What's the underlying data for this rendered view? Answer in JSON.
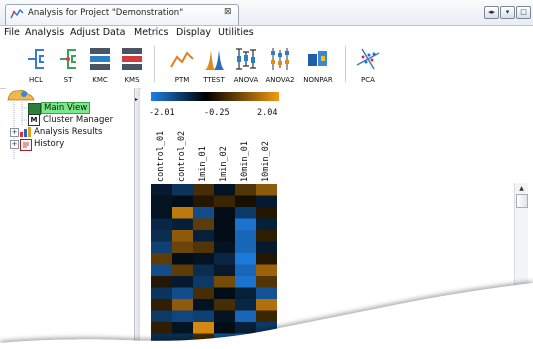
{
  "tab": {
    "title": "Analysis for Project \"Demonstration\"",
    "close": "⊠"
  },
  "window_controls": [
    "◂▸",
    "▾",
    "□"
  ],
  "menu": [
    "File",
    "Analysis",
    "Adjust Data",
    "Metrics",
    "Display",
    "Utilities"
  ],
  "toolbar": [
    {
      "label": "HCL",
      "icon": "hcl-tree-icon"
    },
    {
      "label": "ST",
      "icon": "support-tree-icon"
    },
    {
      "label": "KMC",
      "icon": "kmeans-cluster-icon"
    },
    {
      "label": "KMS",
      "icon": "kmeans-support-icon"
    },
    {
      "label": "PTM",
      "icon": "template-match-icon"
    },
    {
      "label": "TTEST",
      "icon": "ttest-icon"
    },
    {
      "label": "ANOVA",
      "icon": "anova-icon"
    },
    {
      "label": "ANOVA2",
      "icon": "anova2-icon"
    },
    {
      "label": "NONPAR",
      "icon": "nonparametric-icon"
    },
    {
      "label": "PCA",
      "icon": "pca-icon"
    }
  ],
  "tree": {
    "items": [
      {
        "label": "Main View",
        "selected": true
      },
      {
        "label": "Cluster Manager"
      },
      {
        "label": "Analysis Results"
      },
      {
        "label": "History"
      }
    ],
    "expander": "+"
  },
  "heatmap": {
    "scale_labels": [
      "-2.01",
      "-0.25",
      "2.04"
    ],
    "scale_min": -2.01,
    "scale_max": 2.04,
    "colors": {
      "low": "#1e80e6",
      "mid": "#000000",
      "high": "#f09a12"
    },
    "columns": [
      "control_01",
      "control_02",
      "1min_01",
      "1min_02",
      "10min_01",
      "10min_02"
    ],
    "values": [
      [
        -0.4,
        -0.8,
        0.6,
        -0.3,
        0.7,
        1.2
      ],
      [
        -0.3,
        -0.2,
        0.3,
        0.5,
        0.2,
        -0.4
      ],
      [
        -0.3,
        1.6,
        -1.2,
        -0.2,
        -0.9,
        0.3
      ],
      [
        -0.6,
        -0.5,
        0.8,
        -0.2,
        -1.8,
        -0.5
      ],
      [
        -0.7,
        1.2,
        -0.5,
        -0.2,
        -1.6,
        0.4
      ],
      [
        -1.0,
        0.9,
        0.7,
        -0.3,
        -1.6,
        -0.4
      ],
      [
        0.8,
        -0.2,
        -0.3,
        -0.6,
        -1.9,
        0.3
      ],
      [
        -1.2,
        0.8,
        -0.7,
        -0.4,
        -1.6,
        1.3
      ],
      [
        0.3,
        -0.4,
        -0.9,
        1.0,
        -1.8,
        0.7
      ],
      [
        -0.8,
        -1.2,
        0.6,
        -0.2,
        -0.5,
        -1.3
      ],
      [
        0.4,
        1.2,
        -0.3,
        0.6,
        -0.6,
        1.5
      ],
      [
        -0.9,
        -1.1,
        -1.0,
        -0.3,
        -1.6,
        0.5
      ],
      [
        0.4,
        -0.3,
        1.8,
        -0.2,
        -0.5,
        -0.9
      ],
      [
        -0.7,
        -0.7,
        0.6,
        -1.4,
        -1.7,
        0.3
      ]
    ]
  },
  "scrollbar": {
    "up": "▲"
  }
}
